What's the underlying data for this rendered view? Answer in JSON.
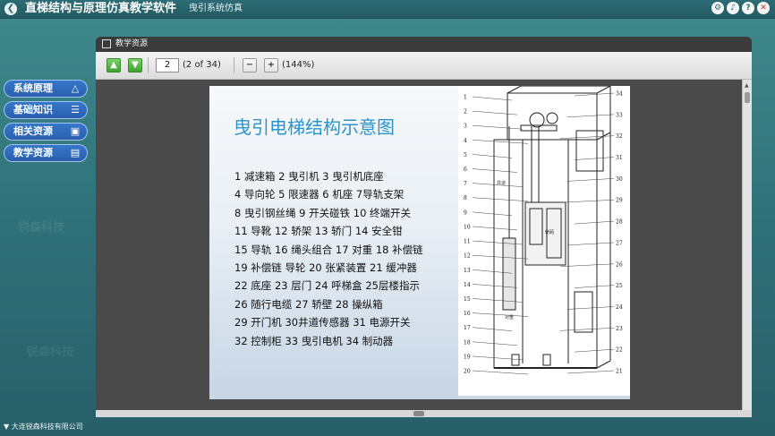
{
  "header": {
    "app_title": "直梯结构与原理仿真教学软件",
    "sub_title": "曳引系统仿真",
    "icons": [
      "settings-icon",
      "volume-icon",
      "help-icon",
      "close-icon"
    ]
  },
  "menu": {
    "items": [
      {
        "label": "系统原理",
        "icon": "network-icon"
      },
      {
        "label": "基础知识",
        "icon": "book-icon"
      },
      {
        "label": "相关资源",
        "icon": "resource-icon"
      },
      {
        "label": "教学资源",
        "icon": "document-icon"
      }
    ]
  },
  "viewer": {
    "title": "教学资源",
    "page_value": "2",
    "page_count_text": "(2 of 34)",
    "zoom_text": "(144%)"
  },
  "page": {
    "title": "曳引电梯结构示意图",
    "parts_lines": [
      "1 减速箱   2 曳引机   3 曳引机底座",
      "4 导向轮   5 限速器   6 机座  7导轨支架",
      "8 曳引钢丝绳  9 开关碰铁   10 终端开关",
      "11 导靴   12 轿架   13 轿门    14 安全钳",
      "15 导轨  16 绳头组合 17 对重  18 补偿链",
      "19 补偿链 导轮  20 张紧装置  21 缓冲器",
      "22  底座  23 层门 24 呼梯盒  25层楼指示",
      "26 随行电缆     27 轿壁          28  操纵箱",
      "29 开门机   30井道传感器    31 电源开关",
      "32 控制柜       33  曳引电机    34 制动器"
    ],
    "diagram_labels_left": [
      "1",
      "2",
      "3",
      "4",
      "5",
      "6",
      "7",
      "8",
      "9",
      "10",
      "11",
      "12",
      "13",
      "14",
      "15",
      "16",
      "17",
      "18",
      "19",
      "20"
    ],
    "diagram_labels_right": [
      "34",
      "33",
      "32",
      "31",
      "30",
      "29",
      "28",
      "27",
      "26",
      "25",
      "24",
      "23",
      "22",
      "21"
    ],
    "diagram_text": [
      "轿厢",
      "对重",
      "井道"
    ]
  },
  "footer": {
    "company": "大连锐森科技有限公司"
  },
  "watermark": "锐森科技"
}
